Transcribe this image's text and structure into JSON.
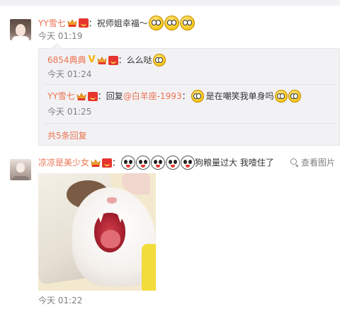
{
  "comments": [
    {
      "username": "YY雪七",
      "separator": "：",
      "text": "祝师姐幸福～",
      "emojis": [
        "emoji-drool-icon",
        "emoji-drool-icon",
        "emoji-drool-icon"
      ],
      "time": "今天 01:19",
      "replies": [
        {
          "username": "6854典典",
          "verified": "V",
          "separator": "：",
          "text": "么么哒",
          "emojis": [
            "emoji-drool-icon"
          ],
          "time": "今天 01:24"
        },
        {
          "username": "YY雪七",
          "separator": "：",
          "reply_prefix": "回复",
          "mention": "@白羊座-1993",
          "mention_separator": "：",
          "text": "是在嘲笑我单身吗",
          "emojis_before": [
            "emoji-sad-icon"
          ],
          "emojis_after": [
            "emoji-sad-icon",
            "emoji-sad-icon"
          ],
          "time": "今天 01:25"
        }
      ],
      "more_replies": "共5条回复"
    },
    {
      "username": "凉凉是美少女",
      "separator": "：",
      "emojis": [
        "panda-icon",
        "panda-icon",
        "panda-icon",
        "panda-icon",
        "panda-icon"
      ],
      "text": "狗粮量过大 我噎住了",
      "view_image": "查看图片",
      "time": "今天 01:22"
    }
  ],
  "colors": {
    "username": "#eb7350",
    "text": "#333333",
    "time": "#808080",
    "reply_bg": "#f2f2f5"
  }
}
